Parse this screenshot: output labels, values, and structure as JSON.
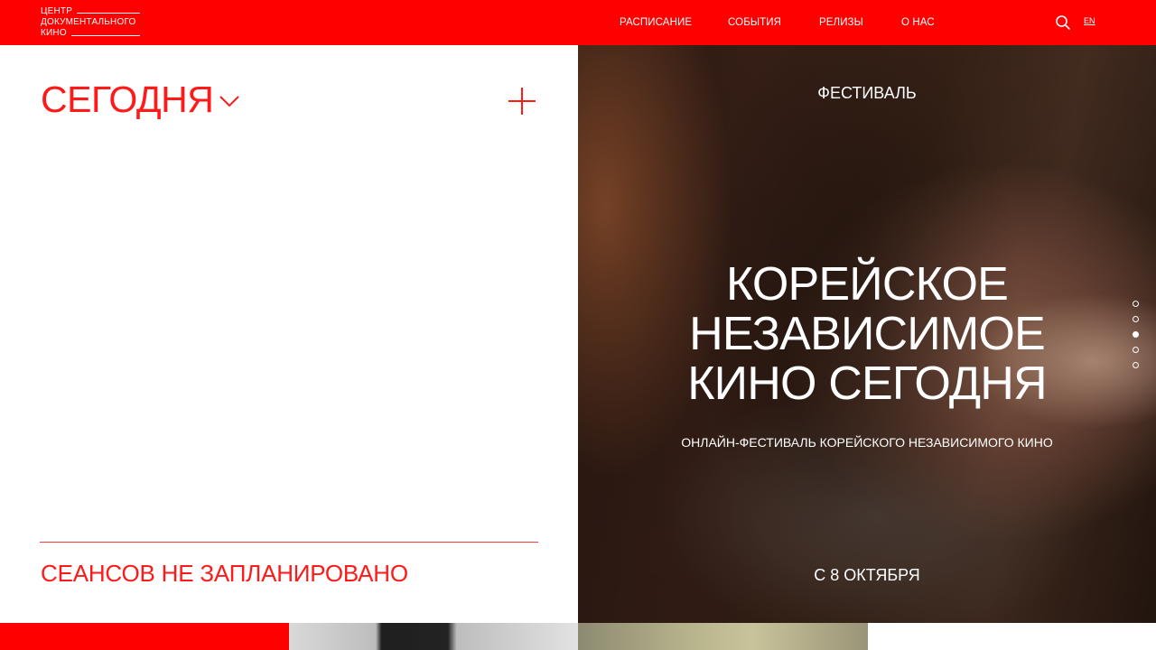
{
  "header": {
    "logo": {
      "line1": "ЦЕНТР",
      "line2": "ДОКУМЕНТАЛЬНОГО",
      "line3": "КИНО"
    },
    "nav": [
      {
        "label": "РАСПИСАНИЕ"
      },
      {
        "label": "СОБЫТИЯ"
      },
      {
        "label": "РЕЛИЗЫ"
      },
      {
        "label": "О НАС"
      }
    ],
    "search_icon": "search-icon",
    "language": "EN"
  },
  "schedule": {
    "date_label": "СЕГОДНЯ",
    "dropdown_icon": "chevron-down-icon",
    "add_icon": "plus-icon",
    "empty_message": "СЕАНСОВ НЕ ЗАПЛАНИРОВАНО"
  },
  "hero": {
    "eyebrow": "ФЕСТИВАЛЬ",
    "title_lines": [
      "КОРЕЙСКОЕ",
      "НЕЗАВИСИМОЕ",
      "КИНО СЕГОДНЯ"
    ],
    "subtitle": "ОНЛАЙН-ФЕСТИВАЛЬ КОРЕЙСКОГО НЕЗАВИСИМОГО КИНО",
    "date": "С 8 ОКТЯБРЯ",
    "slides_count": 5,
    "active_slide": 3
  },
  "colors": {
    "accent": "#ff0000",
    "text_on_accent": "#ffffff"
  }
}
